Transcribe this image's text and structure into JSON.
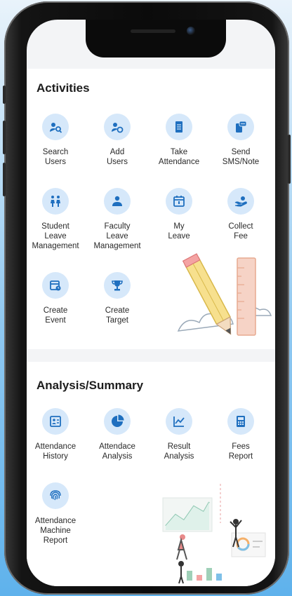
{
  "activities": {
    "title": "Activities",
    "items": [
      {
        "label": "Search\nUsers",
        "icon": "search-user-icon"
      },
      {
        "label": "Add\nUsers",
        "icon": "add-user-icon"
      },
      {
        "label": "Take\nAttendance",
        "icon": "attendance-sheet-icon"
      },
      {
        "label": "Send\nSMS/Note",
        "icon": "message-icon"
      },
      {
        "label": "Student\nLeave\nManagement",
        "icon": "student-leave-icon"
      },
      {
        "label": "Faculty\nLeave\nManagement",
        "icon": "faculty-icon"
      },
      {
        "label": "My\nLeave",
        "icon": "calendar-icon"
      },
      {
        "label": "Collect\nFee",
        "icon": "collect-fee-icon"
      },
      {
        "label": "Create\nEvent",
        "icon": "event-icon"
      },
      {
        "label": "Create\nTarget",
        "icon": "trophy-icon"
      }
    ]
  },
  "analysis": {
    "title": "Analysis/Summary",
    "items": [
      {
        "label": "Attendance\nHistory",
        "icon": "history-icon"
      },
      {
        "label": "Attendace\nAnalysis",
        "icon": "pie-chart-icon"
      },
      {
        "label": "Result\nAnalysis",
        "icon": "line-chart-icon"
      },
      {
        "label": "Fees\nReport",
        "icon": "fees-report-icon"
      },
      {
        "label": "Attendance\nMachine\nReport",
        "icon": "fingerprint-icon"
      }
    ]
  },
  "colors": {
    "icon_blue": "#1f6fbf",
    "circle_bg": "#d6e8fa",
    "phone_frame": "#0b0b0b",
    "background": "#8fc8f0"
  }
}
